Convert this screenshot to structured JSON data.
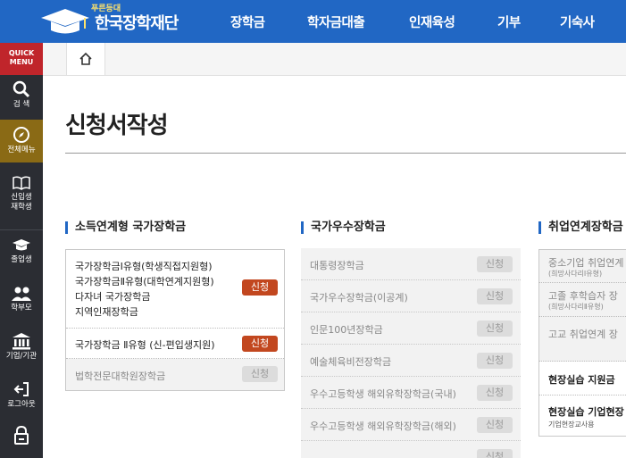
{
  "header": {
    "logo_sub": "푸른등대",
    "logo_text": "한국장학재단",
    "nav": [
      "장학금",
      "학자금대출",
      "인재육성",
      "기부",
      "기숙사"
    ]
  },
  "sidebar": {
    "quick_menu": "QUICK\nMENU",
    "items": [
      {
        "label": "검 색",
        "icon": "search-icon"
      },
      {
        "label": "전체메뉴",
        "icon": "compass-icon"
      },
      {
        "label": "신입생\n재학생",
        "icon": "book-icon"
      },
      {
        "label": "졸업생",
        "icon": "graduation-cap-icon"
      },
      {
        "label": "학부모",
        "icon": "parents-icon"
      },
      {
        "label": "기업/기관",
        "icon": "building-icon"
      },
      {
        "label": "로그아웃",
        "icon": "logout-icon"
      },
      {
        "label": "",
        "icon": "lock-icon"
      }
    ]
  },
  "breadcrumb": {
    "home_icon": "home-icon"
  },
  "page_title": "신청서작성",
  "sections": {
    "income": {
      "title": "소득연계형 국가장학금",
      "group1": {
        "lines": [
          "국가장학금Ⅰ유형(학생직접지원형)",
          "국가장학금Ⅱ유형(대학연계지원형)",
          "다자녀 국가장학금",
          "지역인재장학금"
        ],
        "button": "신청"
      },
      "row2": {
        "label": "국가장학금 Ⅱ유형 (신-편입생지원)",
        "button": "신청"
      },
      "row3": {
        "label": "법학전문대학원장학금",
        "button": "신청"
      }
    },
    "excellence": {
      "title": "국가우수장학금",
      "rows": [
        {
          "label": "대통령장학금",
          "button": "신청"
        },
        {
          "label": "국가우수장학금(이공계)",
          "button": "신청"
        },
        {
          "label": "인문100년장학금",
          "button": "신청"
        },
        {
          "label": "예술체육비전장학금",
          "button": "신청"
        },
        {
          "label": "우수고등학생 해외유학장학금(국내)",
          "button": "신청"
        },
        {
          "label": "우수고등학생 해외유학장학금(해외)",
          "button": "신청"
        },
        {
          "label": "",
          "button": "신청"
        }
      ]
    },
    "employment": {
      "title": "취업연계장학금",
      "rows": [
        {
          "main": "중소기업 취업연계",
          "sub": "(희망사다리Ⅰ유형)"
        },
        {
          "main": "고졸 후학습자 장",
          "sub": "(희망사다리Ⅱ유형)"
        },
        {
          "main": "고교 취업연계 장",
          "sub": ""
        },
        {
          "main": "현장실습 지원금",
          "sub": ""
        },
        {
          "main": "현장실습 기업현장",
          "sub": "기업현장교사용"
        }
      ]
    }
  }
}
